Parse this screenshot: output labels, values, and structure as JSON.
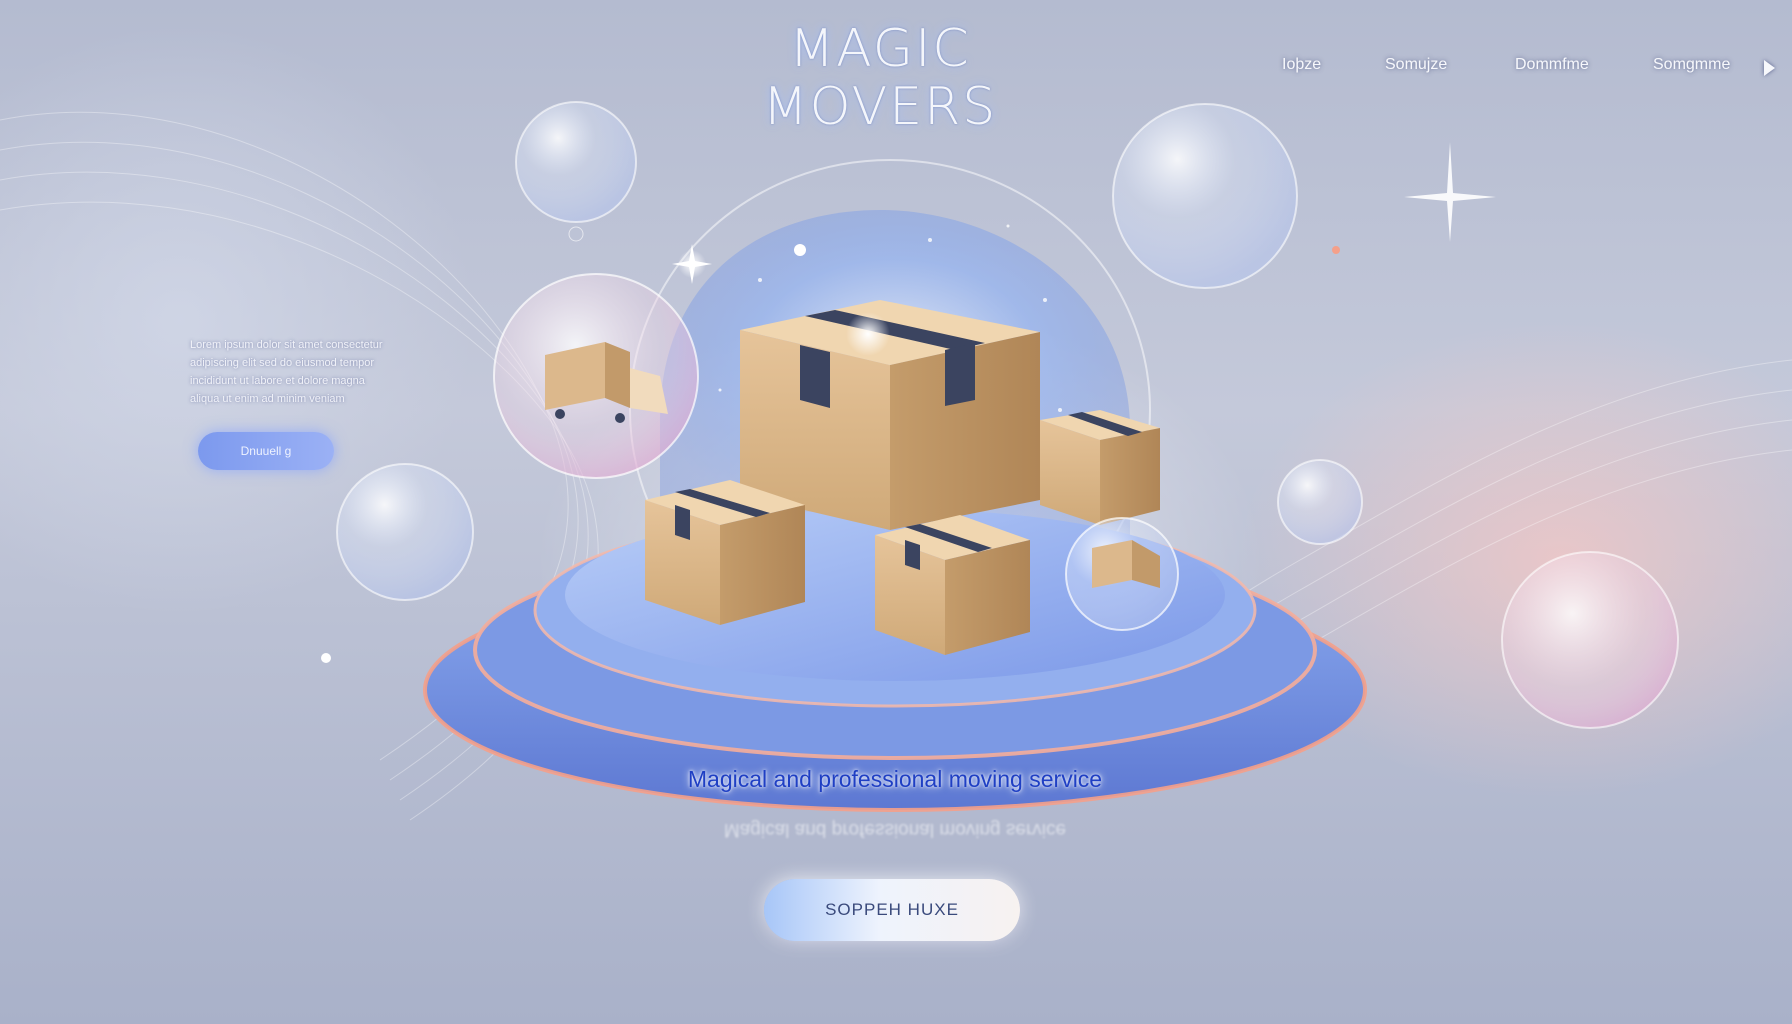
{
  "brand": {
    "logo_line1": "MAGIC",
    "logo_line2": "MOVERS"
  },
  "nav": {
    "items": [
      {
        "label": "Ioþze"
      },
      {
        "label": "Somujze"
      },
      {
        "label": "Dommfme"
      },
      {
        "label": "Somgmme"
      }
    ],
    "play_icon": "play-icon"
  },
  "intro": {
    "text_lines": [
      "Lorem ipsum dolor sit amet consectetur",
      "adipiscing elit sed do eiusmod tempor",
      "incididunt ut labore et dolore magna",
      "aliqua ut enim ad minim veniam"
    ],
    "button_label": "Dnuuell g"
  },
  "hero": {
    "tagline": "Magical and professional moving service",
    "cta_label": "SOPPEH HUXE"
  },
  "colors": {
    "accent_blue": "#1f3fc4",
    "button_blue": "#7c99ee",
    "glow_pink": "#f2a58f",
    "box_tan": "#dcb88c",
    "box_tape": "#3b4460"
  },
  "icons": {
    "truck": "truck-icon",
    "box": "box-icon",
    "sparkle": "sparkle-icon"
  }
}
